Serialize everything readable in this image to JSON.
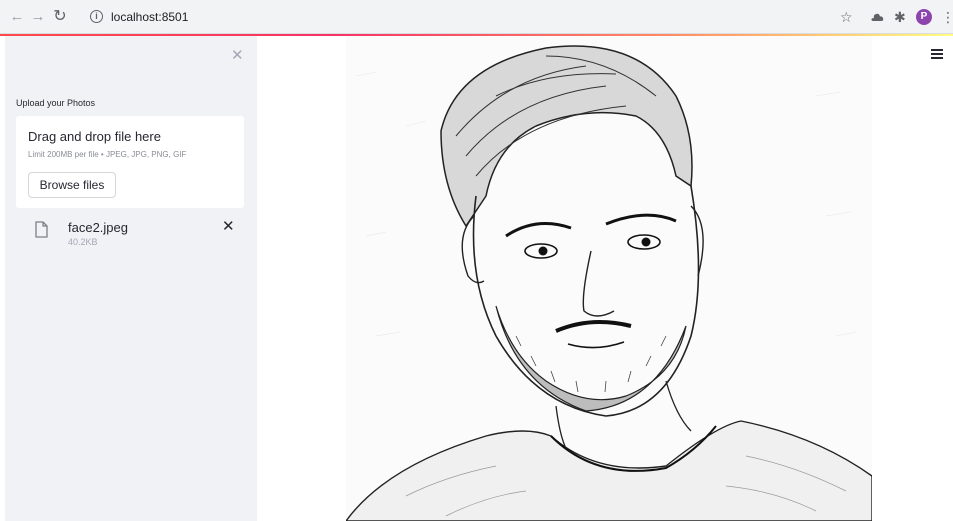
{
  "browser": {
    "back_icon": "arrow-left-icon",
    "forward_icon": "arrow-right-icon",
    "reload_icon": "reload-icon",
    "info_icon": "info-icon",
    "url": "localhost:8501",
    "bookmark_icon": "star-icon",
    "extension_icons": [
      "cloud-extension-icon",
      "puzzle-icon"
    ],
    "profile_initial": "P",
    "profile_color": "#8e44ad",
    "menu_icon": "kebab-menu-icon"
  },
  "sidebar": {
    "close_icon": "close-icon",
    "upload_label": "Upload your Photos",
    "dropzone": {
      "title": "Drag and drop file here",
      "limit": "Limit 200MB per file • JPEG, JPG, PNG, GIF",
      "browse_label": "Browse files"
    },
    "file": {
      "icon": "file-icon",
      "name": "face2.jpeg",
      "size": "40.2KB",
      "remove_icon": "close-icon"
    },
    "background": "#f0f2f6"
  },
  "main": {
    "menu_icon": "hamburger-menu-icon",
    "image_description": "pencil-sketch-portrait"
  },
  "colors": {
    "accent": "#ff4b4b",
    "text": "#262730",
    "muted": "#a3a8b4"
  }
}
